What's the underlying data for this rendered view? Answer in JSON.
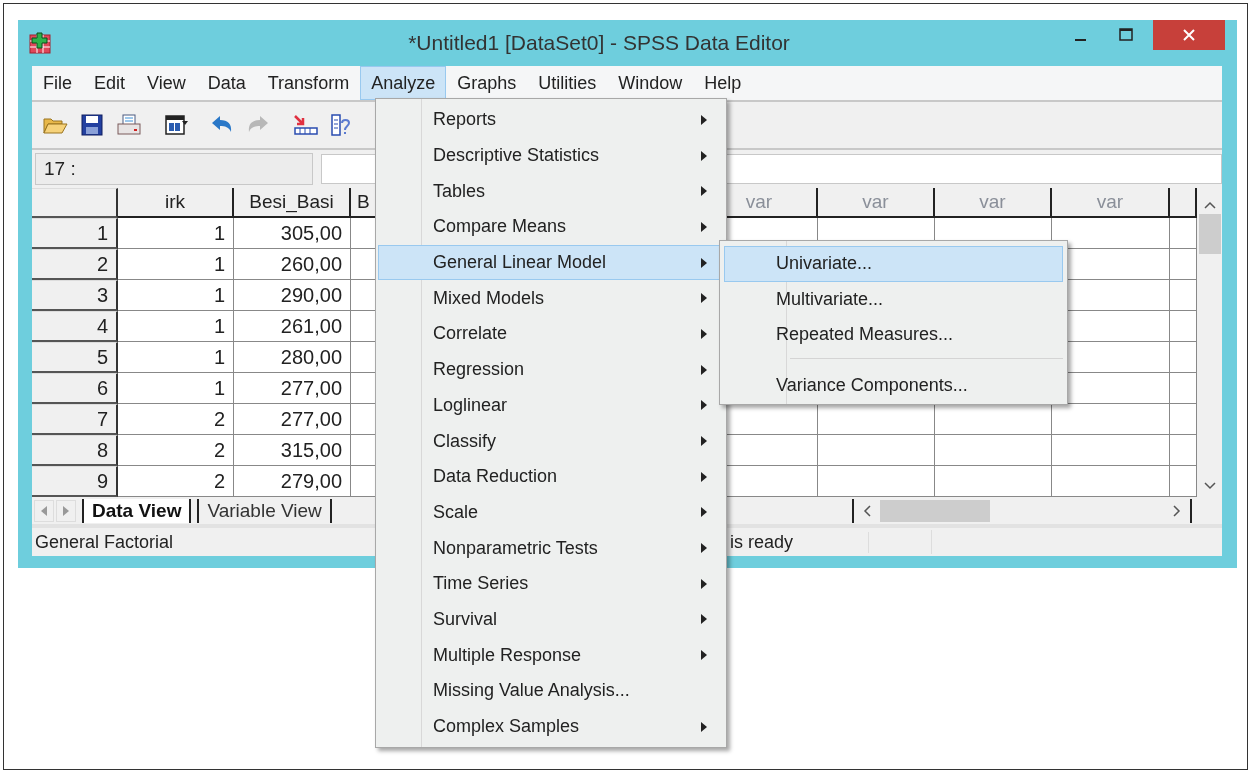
{
  "window": {
    "title": "*Untitled1 [DataSet0] - SPSS Data Editor"
  },
  "menubar": [
    {
      "label": "File",
      "selected": false
    },
    {
      "label": "Edit",
      "selected": false
    },
    {
      "label": "View",
      "selected": false
    },
    {
      "label": "Data",
      "selected": false
    },
    {
      "label": "Transform",
      "selected": false
    },
    {
      "label": "Analyze",
      "selected": true
    },
    {
      "label": "Graphs",
      "selected": false
    },
    {
      "label": "Utilities",
      "selected": false
    },
    {
      "label": "Window",
      "selected": false
    },
    {
      "label": "Help",
      "selected": false
    }
  ],
  "cell_reference": "17 :",
  "table": {
    "columns": [
      "irk",
      "Besi_Basi",
      "B",
      "var",
      "var",
      "var",
      "var"
    ],
    "rows": [
      {
        "number": "1",
        "cells": [
          "1",
          "305,00"
        ]
      },
      {
        "number": "2",
        "cells": [
          "1",
          "260,00"
        ]
      },
      {
        "number": "3",
        "cells": [
          "1",
          "290,00"
        ]
      },
      {
        "number": "4",
        "cells": [
          "1",
          "261,00"
        ]
      },
      {
        "number": "5",
        "cells": [
          "1",
          "280,00"
        ]
      },
      {
        "number": "6",
        "cells": [
          "1",
          "277,00"
        ]
      },
      {
        "number": "7",
        "cells": [
          "2",
          "277,00"
        ]
      },
      {
        "number": "8",
        "cells": [
          "2",
          "315,00"
        ]
      },
      {
        "number": "9",
        "cells": [
          "2",
          "279,00"
        ]
      }
    ]
  },
  "view_tabs": [
    {
      "label": "Data View",
      "selected": true
    },
    {
      "label": "Variable View",
      "selected": false
    }
  ],
  "status_bar": [
    "General Factorial",
    "is ready"
  ],
  "analyze_menu": [
    {
      "label": "Reports",
      "submenu": true,
      "selected": false
    },
    {
      "label": "Descriptive Statistics",
      "submenu": true,
      "selected": false
    },
    {
      "label": "Tables",
      "submenu": true,
      "selected": false
    },
    {
      "label": "Compare Means",
      "submenu": true,
      "selected": false
    },
    {
      "label": "General Linear Model",
      "submenu": true,
      "selected": true
    },
    {
      "label": "Mixed Models",
      "submenu": true,
      "selected": false
    },
    {
      "label": "Correlate",
      "submenu": true,
      "selected": false
    },
    {
      "label": "Regression",
      "submenu": true,
      "selected": false
    },
    {
      "label": "Loglinear",
      "submenu": true,
      "selected": false
    },
    {
      "label": "Classify",
      "submenu": true,
      "selected": false
    },
    {
      "label": "Data Reduction",
      "submenu": true,
      "selected": false
    },
    {
      "label": "Scale",
      "submenu": true,
      "selected": false
    },
    {
      "label": "Nonparametric Tests",
      "submenu": true,
      "selected": false
    },
    {
      "label": "Time Series",
      "submenu": true,
      "selected": false
    },
    {
      "label": "Survival",
      "submenu": true,
      "selected": false
    },
    {
      "label": "Multiple Response",
      "submenu": true,
      "selected": false
    },
    {
      "label": "Missing Value Analysis...",
      "submenu": false,
      "selected": false
    },
    {
      "label": "Complex Samples",
      "submenu": true,
      "selected": false
    }
  ],
  "glm_submenu": [
    {
      "kind": "item",
      "label": "Univariate...",
      "selected": true
    },
    {
      "kind": "item",
      "label": "Multivariate...",
      "selected": false
    },
    {
      "kind": "item",
      "label": "Repeated Measures...",
      "selected": false
    },
    {
      "kind": "separator"
    },
    {
      "kind": "item",
      "label": "Variance Components...",
      "selected": false
    }
  ]
}
